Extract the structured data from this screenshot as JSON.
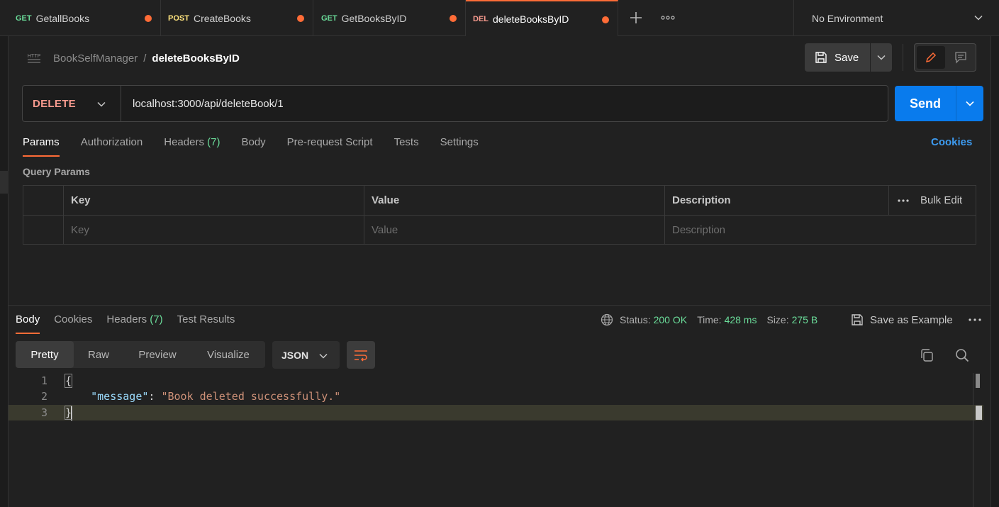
{
  "tabs": [
    {
      "method": "GET",
      "name": "GetallBooks"
    },
    {
      "method": "POST",
      "name": "CreateBooks"
    },
    {
      "method": "GET",
      "name": "GetBooksByID"
    },
    {
      "method": "DEL",
      "name": "deleteBooksByID"
    }
  ],
  "environment": {
    "label": "No Environment"
  },
  "breadcrumb": {
    "collection": "BookSelfManager",
    "separator": "/",
    "request": "deleteBooksByID",
    "icon_text": "HTTP"
  },
  "toolbar": {
    "save_label": "Save"
  },
  "request": {
    "method": "DELETE",
    "url": "localhost:3000/api/deleteBook/1",
    "send_label": "Send"
  },
  "request_tabs": {
    "params": "Params",
    "authorization": "Authorization",
    "headers": "Headers",
    "headers_count": "(7)",
    "body": "Body",
    "prerequest": "Pre-request Script",
    "tests": "Tests",
    "settings": "Settings",
    "cookies": "Cookies"
  },
  "query_params": {
    "title": "Query Params",
    "headers": {
      "key": "Key",
      "value": "Value",
      "description": "Description",
      "bulk_edit": "Bulk Edit"
    },
    "placeholders": {
      "key": "Key",
      "value": "Value",
      "description": "Description"
    }
  },
  "response": {
    "tabs": {
      "body": "Body",
      "cookies": "Cookies",
      "headers": "Headers",
      "headers_count": "(7)",
      "test_results": "Test Results"
    },
    "status_label": "Status:",
    "status_value": "200 OK",
    "time_label": "Time:",
    "time_value": "428 ms",
    "size_label": "Size:",
    "size_value": "275 B",
    "save_example": "Save as Example",
    "formats": [
      "Pretty",
      "Raw",
      "Preview",
      "Visualize"
    ],
    "active_format": "Pretty",
    "language": "JSON",
    "lines": [
      {
        "num": "1",
        "text": "{"
      },
      {
        "num": "2",
        "key": "\"message\"",
        "colon": ": ",
        "value": "\"Book deleted successfully.\""
      },
      {
        "num": "3",
        "text": "}"
      }
    ]
  },
  "colors": {
    "accent": "#ff6c37",
    "send": "#097bed",
    "get": "#6bdd9a",
    "post": "#ffe47e",
    "delete": "#f79a8e",
    "link": "#3d9bf0"
  }
}
